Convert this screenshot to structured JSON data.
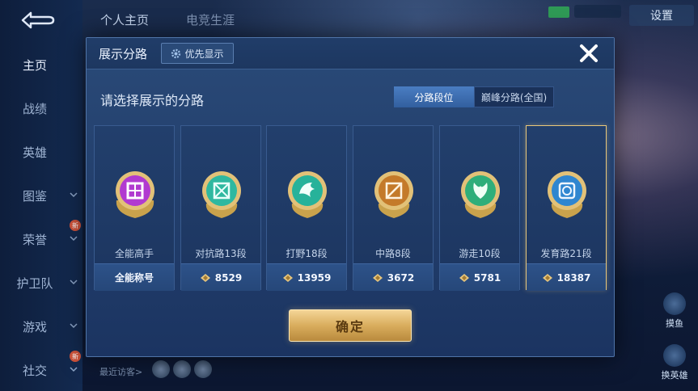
{
  "sidebar": {
    "items": [
      {
        "label": "主页",
        "active": true
      },
      {
        "label": "战绩"
      },
      {
        "label": "英雄"
      },
      {
        "label": "图鉴",
        "expandable": true
      },
      {
        "label": "荣誉",
        "expandable": true,
        "badge": "新"
      },
      {
        "label": "护卫队",
        "expandable": true
      },
      {
        "label": "游戏",
        "expandable": true
      },
      {
        "label": "社交",
        "expandable": true,
        "badge": "新"
      }
    ]
  },
  "topbar": {
    "tabs": [
      "个人主页",
      "电竞生涯"
    ],
    "settings_label": "设置"
  },
  "modal": {
    "title": "展示分路",
    "priority_label": "优先显示",
    "subtitle": "请选择展示的分路",
    "segments": [
      "分路段位",
      "巅峰分路(全国)"
    ],
    "confirm_label": "确定",
    "cards": [
      {
        "name": "全能高手",
        "footer": "全能称号",
        "icon": "allround-emblem",
        "color": "#b13ad0",
        "show_icon": false
      },
      {
        "name": "对抗路13段",
        "footer": "8529",
        "icon": "clash-lane-emblem",
        "color": "#2fb8a0",
        "show_icon": true
      },
      {
        "name": "打野18段",
        "footer": "13959",
        "icon": "jungle-emblem",
        "color": "#27b29a",
        "show_icon": true
      },
      {
        "name": "中路8段",
        "footer": "3672",
        "icon": "mid-lane-emblem",
        "color": "#c47a2a",
        "show_icon": true
      },
      {
        "name": "游走10段",
        "footer": "5781",
        "icon": "roam-emblem",
        "color": "#2fae7a",
        "show_icon": true
      },
      {
        "name": "发育路21段",
        "footer": "18387",
        "icon": "farm-lane-emblem",
        "color": "#2f86d0",
        "show_icon": true,
        "selected": true
      }
    ]
  },
  "bottom": {
    "visit_label": "最近访客>"
  },
  "right_buttons": [
    {
      "label": "摸鱼"
    },
    {
      "label": "换英雄"
    }
  ]
}
